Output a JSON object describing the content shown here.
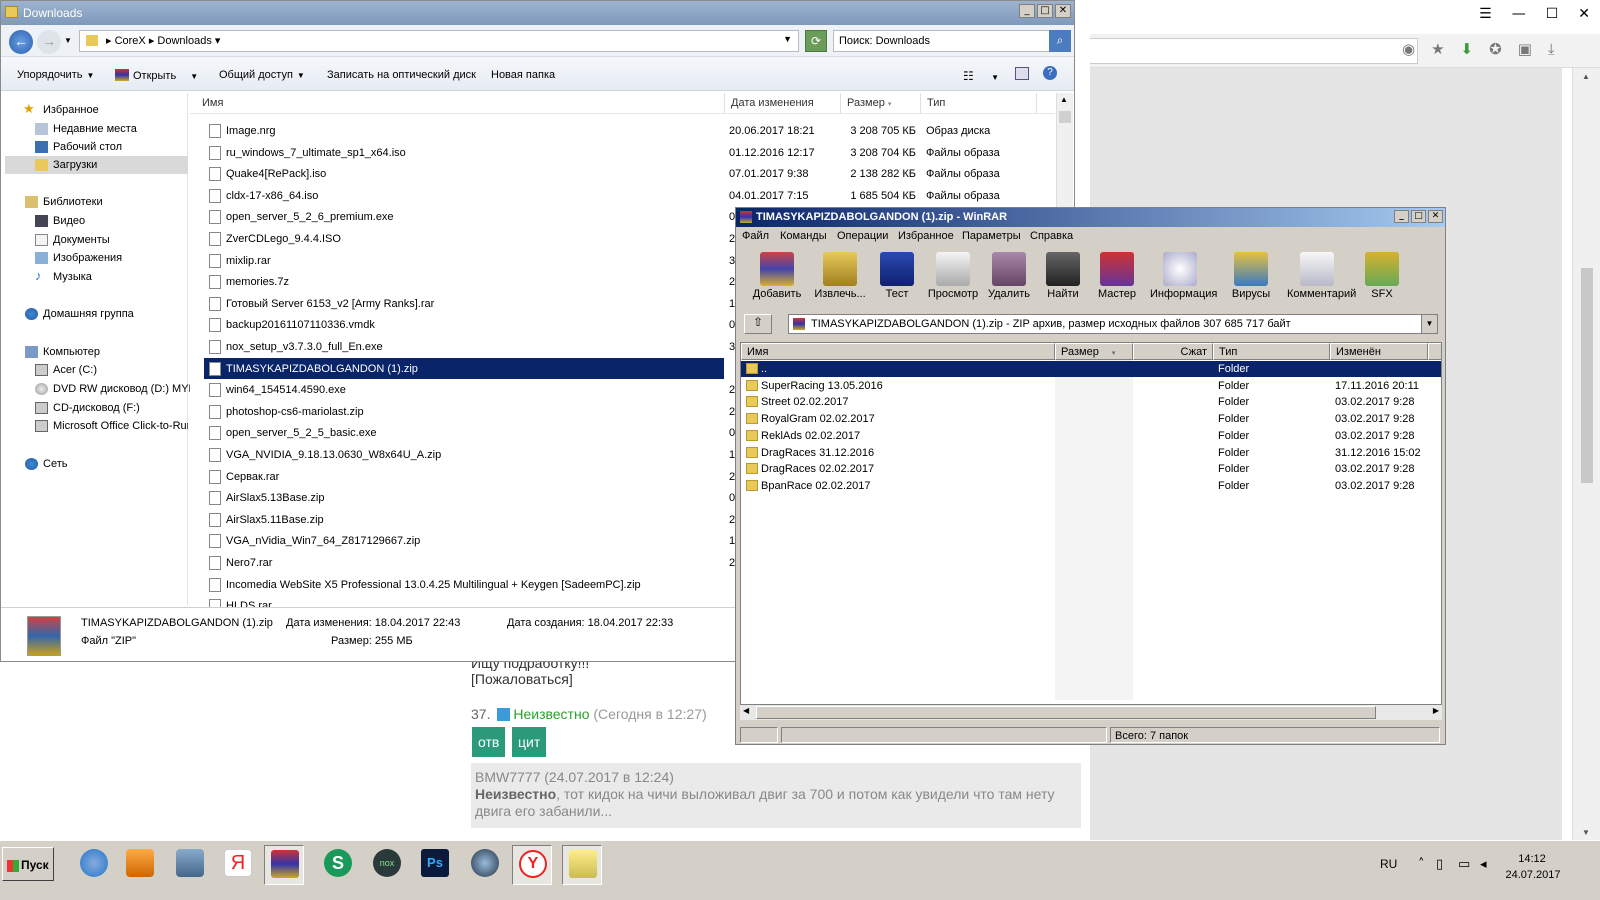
{
  "browser": {
    "comment_tail_1": "Ищу подработку!!!",
    "comment_tail_2": "[Пожаловаться]",
    "comment_num": "37.",
    "comment_user": "Неизвестно",
    "comment_time": "(Сегодня в 12:27)",
    "btn_reply": "отв",
    "btn_quote": "цит",
    "quote_head": "BMW7777 (24.07.2017 в 12:24)",
    "quote_user": "Неизвестно",
    "quote_text": ", тот кидок на чичи выложивал двиг за 700 и потом как увидели что там нету двига его забанили..."
  },
  "explorer": {
    "title": "Downloads",
    "breadcrumb": [
      "CoreX",
      "Downloads"
    ],
    "search_placeholder": "Поиск: Downloads",
    "toolbar": {
      "organize": "Упорядочить",
      "open": "Открыть",
      "share": "Общий доступ",
      "burn": "Записать на оптический диск",
      "new_folder": "Новая папка"
    },
    "nav": {
      "favorites": "Избранное",
      "recent": "Недавние места",
      "desktop": "Рабочий стол",
      "downloads": "Загрузки",
      "libraries": "Библиотеки",
      "video": "Видео",
      "documents": "Документы",
      "images": "Изображения",
      "music": "Музыка",
      "homegroup": "Домашняя группа",
      "computer": "Компьютер",
      "drive_c": "Acer (C:)",
      "drive_d": "DVD RW дисковод (D:) MYD",
      "drive_f": "CD-дисковод (F:)",
      "office": "Microsoft Office Click-to-Run",
      "network": "Сеть"
    },
    "columns": {
      "name": "Имя",
      "date": "Дата изменения",
      "size": "Размер",
      "type": "Тип"
    },
    "files": [
      {
        "name": "Image.nrg",
        "date": "20.06.2017 18:21",
        "size": "3 208 705 КБ",
        "type": "Образ диска"
      },
      {
        "name": "ru_windows_7_ultimate_sp1_x64.iso",
        "date": "01.12.2016 12:17",
        "size": "3 208 704 КБ",
        "type": "Файлы образа"
      },
      {
        "name": "Quake4[RePack].iso",
        "date": "07.01.2017 9:38",
        "size": "2 138 282 КБ",
        "type": "Файлы образа"
      },
      {
        "name": "cldx-17-x86_64.iso",
        "date": "04.01.2017 7:15",
        "size": "1 685 504 КБ",
        "type": "Файлы образа"
      },
      {
        "name": "open_server_5_2_6_premium.exe",
        "date": "0",
        "size": "",
        "type": ""
      },
      {
        "name": "ZverCDLego_9.4.4.ISO",
        "date": "2",
        "size": "",
        "type": ""
      },
      {
        "name": "mixlip.rar",
        "date": "3",
        "size": "",
        "type": ""
      },
      {
        "name": "memories.7z",
        "date": "2",
        "size": "",
        "type": ""
      },
      {
        "name": "Готовый Server 6153_v2 [Army Ranks].rar",
        "date": "1",
        "size": "",
        "type": ""
      },
      {
        "name": "backup20161107110336.vmdk",
        "date": "0",
        "size": "",
        "type": ""
      },
      {
        "name": "nox_setup_v3.7.3.0_full_En.exe",
        "date": "3",
        "size": "",
        "type": ""
      },
      {
        "name": "TIMASYKAPIZDABOLGANDON (1).zip",
        "date": "1",
        "size": "",
        "type": ""
      },
      {
        "name": "win64_154514.4590.exe",
        "date": "2",
        "size": "",
        "type": ""
      },
      {
        "name": "photoshop-cs6-mariolast.zip",
        "date": "2",
        "size": "",
        "type": ""
      },
      {
        "name": "open_server_5_2_5_basic.exe",
        "date": "0",
        "size": "",
        "type": ""
      },
      {
        "name": "VGA_NVIDIA_9.18.13.0630_W8x64U_A.zip",
        "date": "1",
        "size": "",
        "type": ""
      },
      {
        "name": "Сервак.rar",
        "date": "2",
        "size": "",
        "type": ""
      },
      {
        "name": "AirSlax5.13Base.zip",
        "date": "0",
        "size": "",
        "type": ""
      },
      {
        "name": "AirSlax5.11Base.zip",
        "date": "2",
        "size": "",
        "type": ""
      },
      {
        "name": "VGA_nVidia_Win7_64_Z817129667.zip",
        "date": "1",
        "size": "",
        "type": ""
      },
      {
        "name": "Nero7.rar",
        "date": "2",
        "size": "",
        "type": ""
      },
      {
        "name": "Incomedia WebSite X5 Professional 13.0.4.25 Multilingual + Keygen [SadeemPC].zip",
        "date": "",
        "size": "",
        "type": ""
      },
      {
        "name": "HLDS.rar",
        "date": "",
        "size": "",
        "type": ""
      }
    ],
    "details": {
      "filename": "TIMASYKAPIZDABOLGANDON (1).zip",
      "filetype": "Файл \"ZIP\"",
      "modified": "Дата изменения: 18.04.2017 22:43",
      "size": "Размер: 255 МБ",
      "created": "Дата создания: 18.04.2017 22:33"
    }
  },
  "winrar": {
    "title": "TIMASYKAPIZDABOLGANDON (1).zip - WinRAR",
    "menu": [
      "Файл",
      "Команды",
      "Операции",
      "Избранное",
      "Параметры",
      "Справка"
    ],
    "tools": [
      "Добавить",
      "Извлечь...",
      "Тест",
      "Просмотр",
      "Удалить",
      "Найти",
      "Мастер",
      "Информация",
      "Вирусы",
      "Комментарий",
      "SFX"
    ],
    "path": "TIMASYKAPIZDABOLGANDON (1).zip - ZIP архив, размер исходных файлов 307 685 717 байт",
    "columns": {
      "name": "Имя",
      "size": "Размер",
      "packed": "Сжат",
      "type": "Тип",
      "modified": "Изменён"
    },
    "rows": [
      {
        "name": "..",
        "type": "Folder",
        "date": ""
      },
      {
        "name": "SuperRacing 13.05.2016",
        "type": "Folder",
        "date": "17.11.2016 20:11"
      },
      {
        "name": "Street 02.02.2017",
        "type": "Folder",
        "date": "03.02.2017 9:28"
      },
      {
        "name": "RoyalGram 02.02.2017",
        "type": "Folder",
        "date": "03.02.2017 9:28"
      },
      {
        "name": "ReklAds 02.02.2017",
        "type": "Folder",
        "date": "03.02.2017 9:28"
      },
      {
        "name": "DragRaces 31.12.2016",
        "type": "Folder",
        "date": "31.12.2016 15:02"
      },
      {
        "name": "DragRaces 02.02.2017",
        "type": "Folder",
        "date": "03.02.2017 9:28"
      },
      {
        "name": "BpanRace 02.02.2017",
        "type": "Folder",
        "date": "03.02.2017 9:28"
      }
    ],
    "status": "Всего: 7 папок"
  },
  "taskbar": {
    "start": "Пуск",
    "lang": "RU",
    "time": "14:12",
    "date": "24.07.2017"
  }
}
